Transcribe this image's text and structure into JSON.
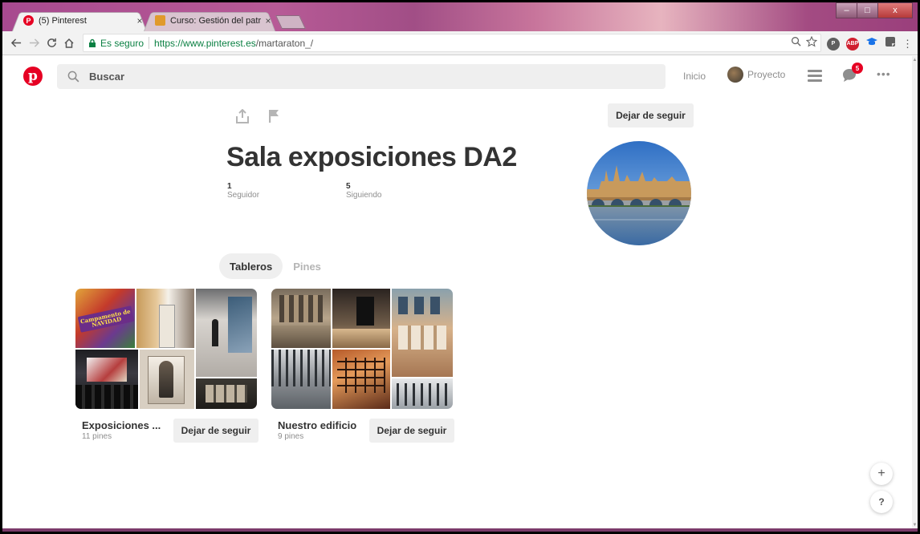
{
  "browser": {
    "tabs": [
      {
        "title": "(5) Pinterest",
        "close": "×",
        "active": true
      },
      {
        "title": "Curso: Gestión del patrin",
        "close": "×",
        "active": false
      }
    ],
    "window_controls": {
      "minimize": "–",
      "maximize": "□",
      "close": "x"
    },
    "secure_label": "Es seguro",
    "url_host": "https://www.pinterest.es",
    "url_path": "/martaraton_/",
    "extensions": [
      {
        "name": "pinterest-extension-icon",
        "label": "",
        "color": "#5f5f5f"
      },
      {
        "name": "adblock-plus-icon",
        "label": "ABP",
        "color": "#d01f2f"
      },
      {
        "name": "graduation-cap-icon",
        "label": "",
        "color": "#1a73e8"
      },
      {
        "name": "note-extension-icon",
        "label": "",
        "color": "#5f5f5f"
      }
    ]
  },
  "header": {
    "search_placeholder": "Buscar",
    "home_label": "Inicio",
    "profile_label": "Proyecto",
    "notifications_count": "5"
  },
  "profile": {
    "name": "Sala exposiciones DA2",
    "followers_count": "1",
    "followers_label": "Seguidor",
    "following_count": "5",
    "following_label": "Siguiendo",
    "unfollow_label": "Dejar de seguir"
  },
  "tabs": {
    "boards": "Tableros",
    "pins": "Pines"
  },
  "boards": [
    {
      "name": "Exposiciones ...",
      "count": "11 pines",
      "unfollow_label": "Dejar de seguir",
      "cover_title": "Campamento de NAVIDAD"
    },
    {
      "name": "Nuestro edificio",
      "count": "9 pines",
      "unfollow_label": "Dejar de seguir"
    }
  ],
  "floating": {
    "add": "+",
    "help": "?"
  },
  "colors": {
    "brand": "#e60023",
    "chrome_tabstrip": "#a74a8f",
    "button_bg": "#efefef"
  }
}
